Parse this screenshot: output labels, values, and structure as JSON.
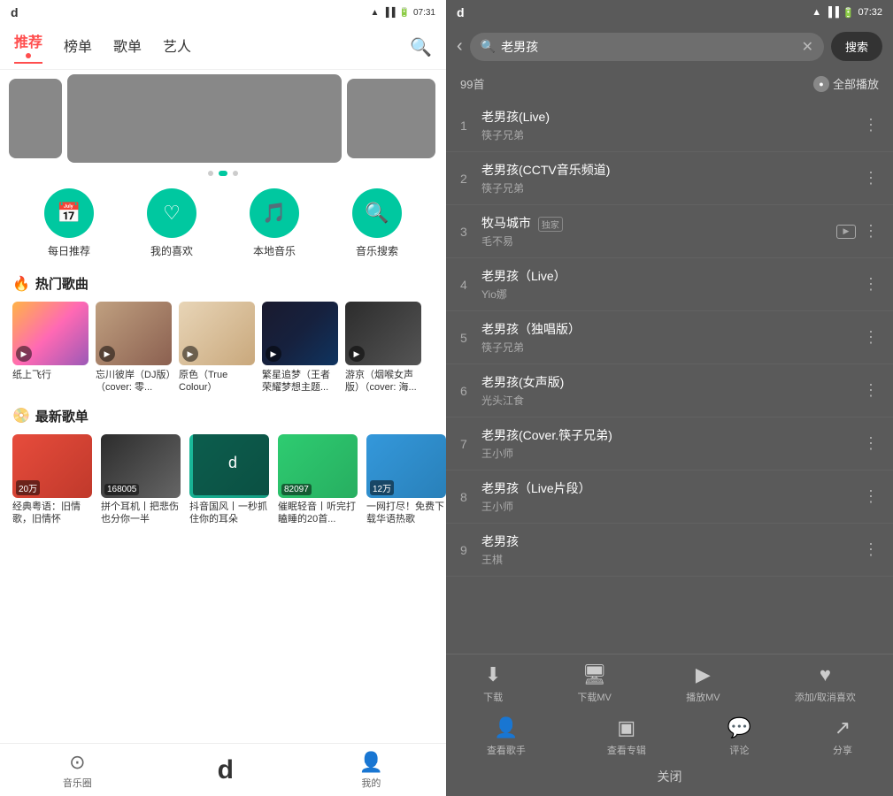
{
  "left": {
    "status": {
      "time": "07:31",
      "app_icon": "d"
    },
    "nav": {
      "tabs": [
        "推荐",
        "榜单",
        "歌单",
        "艺人"
      ],
      "active": 0
    },
    "banners": {
      "dots": [
        false,
        true,
        false
      ]
    },
    "quick_actions": [
      {
        "label": "每日推荐",
        "icon": "📅"
      },
      {
        "label": "我的喜欢",
        "icon": "♡"
      },
      {
        "label": "本地音乐",
        "icon": "🎵"
      },
      {
        "label": "音乐搜索",
        "icon": "🔍"
      }
    ],
    "hot_songs": {
      "title": "热门歌曲",
      "items": [
        {
          "name": "纸上飞行"
        },
        {
          "name": "忘川彼岸（DJ版）（cover: 零..."
        },
        {
          "name": "原色（True Colour）"
        },
        {
          "name": "繁星追梦（王者荣耀梦想主题..."
        },
        {
          "name": "游京（烟喉女声版）（cover: 海..."
        }
      ]
    },
    "new_albums": {
      "title": "最新歌单",
      "items": [
        {
          "name": "经典粤语：旧情歌，旧情怀",
          "badge": "20万"
        },
        {
          "name": "拼个耳机丨把悲伤也分你一半",
          "badge": "168005"
        },
        {
          "name": "抖音国风丨一秒抓住你的耳朵",
          "badge": ""
        },
        {
          "name": "催眠轻音丨听完打瞌睡的20首...",
          "badge": "82097"
        },
        {
          "name": "一网打尽！免费下载华语热歌",
          "badge": "12万"
        }
      ]
    },
    "bottom_nav": {
      "items": [
        "音乐圈",
        "",
        "我的"
      ],
      "logo": "d"
    }
  },
  "right": {
    "status": {
      "time": "07:32",
      "app_icon": "d"
    },
    "search": {
      "query": "老男孩",
      "button_label": "搜索",
      "placeholder": "老男孩"
    },
    "results": {
      "count": "99首",
      "play_all": "全部播放"
    },
    "songs": [
      {
        "num": 1,
        "title": "老男孩(Live)",
        "artist": "筷子兄弟",
        "has_mv": false
      },
      {
        "num": 2,
        "title": "老男孩(CCTV音乐频道)",
        "artist": "筷子兄弟",
        "has_mv": false
      },
      {
        "num": 3,
        "title": "牧马城市",
        "artist": "毛不易",
        "has_mv": true,
        "tag": "独家"
      },
      {
        "num": 4,
        "title": "老男孩（Live）",
        "artist": "Yio娜",
        "has_mv": false
      },
      {
        "num": 5,
        "title": "老男孩（独唱版）",
        "artist": "筷子兄弟",
        "has_mv": false
      },
      {
        "num": 6,
        "title": "老男孩(女声版)",
        "artist": "光头江食",
        "has_mv": false
      },
      {
        "num": 7,
        "title": "老男孩(Cover.筷子兄弟)",
        "artist": "王小师",
        "has_mv": false
      },
      {
        "num": 8,
        "title": "老男孩（Live片段）",
        "artist": "王小师",
        "has_mv": false
      },
      {
        "num": 9,
        "title": "老男孩",
        "artist": "王棋",
        "has_mv": false
      }
    ],
    "action_rows": [
      [
        {
          "icon": "⬇",
          "label": "下载"
        },
        {
          "icon": "📺",
          "label": "下载MV"
        },
        {
          "icon": "▶",
          "label": "播放MV"
        },
        {
          "icon": "♥",
          "label": "添加/取消喜欢"
        }
      ],
      [
        {
          "icon": "👤",
          "label": "查看歌手"
        },
        {
          "icon": "▣",
          "label": "查看专辑"
        },
        {
          "icon": "💬",
          "label": "评论"
        },
        {
          "icon": "↗",
          "label": "分享"
        }
      ]
    ],
    "close_label": "关闭"
  }
}
